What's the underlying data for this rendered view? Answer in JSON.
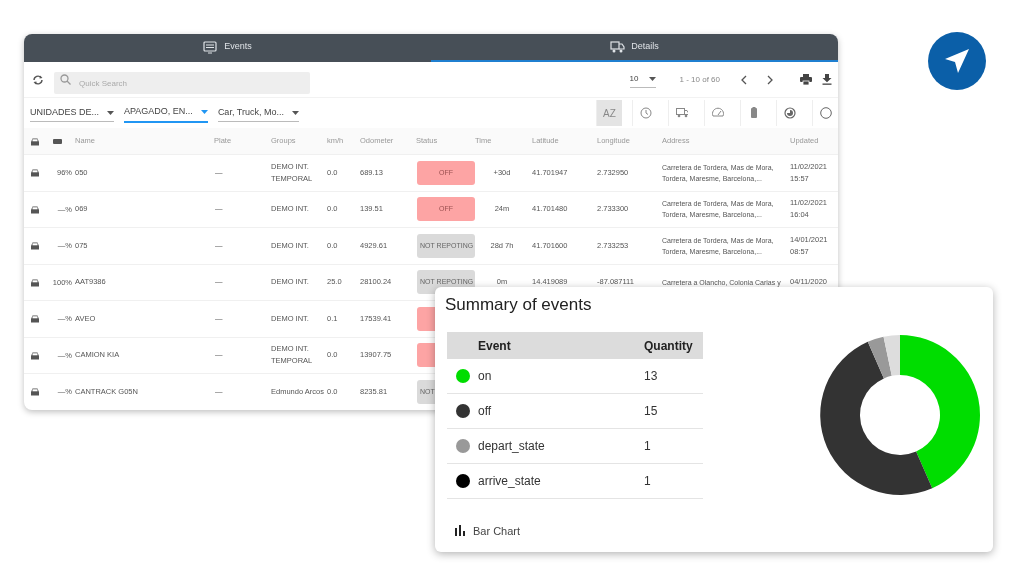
{
  "tabs": [
    {
      "label": "Events",
      "selected": false
    },
    {
      "label": "Details",
      "selected": true
    }
  ],
  "toolbar": {
    "search": {
      "placeholder": "Quick Search"
    },
    "page_size": "10",
    "range": "1 - 10 of 60"
  },
  "filters": [
    {
      "value": "UNIDADES DE...",
      "focused": false
    },
    {
      "value": "APAGADO, EN...",
      "focused": true
    },
    {
      "value": "Car, Truck, Mo...",
      "focused": false
    }
  ],
  "view_buttons": [
    {
      "kind": "az",
      "label": "AZ",
      "selected": true
    },
    {
      "kind": "clock",
      "selected": false
    },
    {
      "kind": "truck",
      "selected": false
    },
    {
      "kind": "gauge",
      "selected": false
    },
    {
      "kind": "battery",
      "selected": false
    },
    {
      "kind": "half",
      "selected": false
    },
    {
      "kind": "circle",
      "selected": false
    }
  ],
  "columns": [
    {
      "kind": "car"
    },
    {
      "kind": "battery"
    },
    {
      "kind": "text",
      "label": "Name"
    },
    {
      "kind": "text",
      "label": "Plate"
    },
    {
      "kind": "text",
      "label": "Groups"
    },
    {
      "kind": "text",
      "label": "km/h"
    },
    {
      "kind": "text",
      "label": "Odometer"
    },
    {
      "kind": "text",
      "label": "Status"
    },
    {
      "kind": "text",
      "label": "Time"
    },
    {
      "kind": "text",
      "label": "Latitude"
    },
    {
      "kind": "text",
      "label": "Longitude"
    },
    {
      "kind": "text",
      "label": "Address"
    },
    {
      "kind": "text",
      "label": "Updated"
    }
  ],
  "rows": [
    {
      "battery": "96%",
      "name": "050",
      "plate": "—",
      "groups": "DEMO INT. TEMPORAL",
      "speed": "0.0",
      "odometer": "689.13",
      "status": {
        "kind": "off",
        "text": "OFF"
      },
      "time": "+30d",
      "latitude": "41.701947",
      "longitude": "2.732950",
      "address": "Carretera de Tordera, Mas de Mora, Tordera, Maresme, Barcelona,...",
      "updated": "11/02/2021 15:57"
    },
    {
      "battery": "—%",
      "name": "069",
      "plate": "—",
      "groups": "DEMO INT.",
      "speed": "0.0",
      "odometer": "139.51",
      "status": {
        "kind": "off",
        "text": "OFF"
      },
      "time": "24m",
      "latitude": "41.701480",
      "longitude": "2.733300",
      "address": "Carretera de Tordera, Mas de Mora, Tordera, Maresme, Barcelona,...",
      "updated": "11/02/2021 16:04"
    },
    {
      "battery": "—%",
      "name": "075",
      "plate": "—",
      "groups": "DEMO INT.",
      "speed": "0.0",
      "odometer": "4929.61",
      "status": {
        "kind": "not_reporting",
        "text": "NOT REPOTING"
      },
      "time": "28d 7h",
      "latitude": "41.701600",
      "longitude": "2.733253",
      "address": "Carretera de Tordera, Mas de Mora, Tordera, Maresme, Barcelona,...",
      "updated": "14/01/2021 08:57"
    },
    {
      "battery": "100%",
      "name": "AAT9386",
      "plate": "—",
      "groups": "DEMO INT.",
      "speed": "25.0",
      "odometer": "28100.24",
      "status": {
        "kind": "not_reporting",
        "text": "NOT REPOTING"
      },
      "time": "0m",
      "latitude": "14.419089",
      "longitude": "-87.087111",
      "address": "Carretera a Olancho, Colonia Carias y",
      "updated": "04/11/2020"
    },
    {
      "battery": "—%",
      "name": "AVEO",
      "plate": "—",
      "groups": "DEMO INT.",
      "speed": "0.1",
      "odometer": "17539.41",
      "status": {
        "kind": "off"
      }
    },
    {
      "battery": "—%",
      "name": "CAMION KIA",
      "plate": "—",
      "groups": "DEMO INT. TEMPORAL",
      "speed": "0.0",
      "odometer": "13907.75",
      "status": {
        "kind": "off"
      }
    },
    {
      "battery": "—%",
      "name": "CANTRACK G05N",
      "plate": "—",
      "groups": "Edmundo Arcos",
      "speed": "0.0",
      "odometer": "8235.81",
      "status": {
        "kind": "not_reporting",
        "text": "NOT"
      }
    }
  ],
  "summary": {
    "title": "Summary of events",
    "columns": [
      "Event",
      "Quantity"
    ],
    "events": [
      {
        "name": "on",
        "quantity": "13",
        "color": "#00dd00"
      },
      {
        "name": "off",
        "quantity": "15",
        "color": "#333333"
      },
      {
        "name": "depart_state",
        "quantity": "1",
        "color": "#999999"
      },
      {
        "name": "arrive_state",
        "quantity": "1",
        "color": "#000000"
      }
    ],
    "chart_data": {
      "type": "donut",
      "colors": [
        "#00dd00",
        "#333333",
        "#999999",
        "#dddddd"
      ],
      "series": [
        {
          "values": [
            43.4,
            50,
            3.3,
            3.3
          ]
        }
      ]
    },
    "bar_chart_button": "Bar Chart"
  }
}
